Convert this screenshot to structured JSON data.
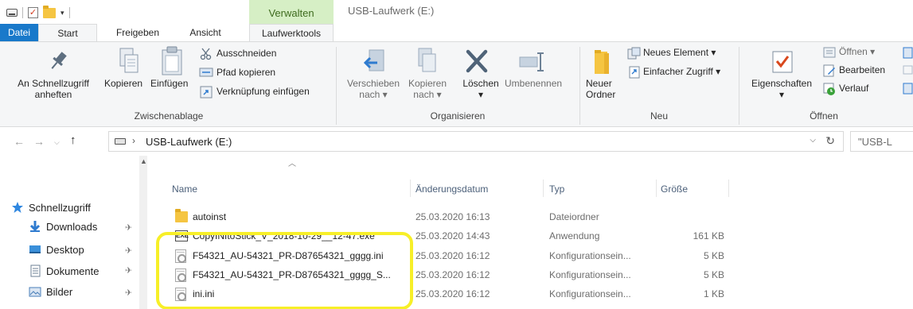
{
  "window": {
    "title": "USB-Laufwerk (E:)",
    "context_tab": "Verwalten"
  },
  "tabs": [
    {
      "label": "Datei"
    },
    {
      "label": "Start"
    },
    {
      "label": "Freigeben"
    },
    {
      "label": "Ansicht"
    },
    {
      "label": "Laufwerktools"
    }
  ],
  "ribbon": {
    "clipboard": {
      "label": "Zwischenablage",
      "pin_line1": "An Schnellzugriff",
      "pin_line2": "anheften",
      "copy": "Kopieren",
      "paste": "Einfügen",
      "cut": "Ausschneiden",
      "copy_path": "Pfad kopieren",
      "paste_shortcut": "Verknüpfung einfügen"
    },
    "organize": {
      "label": "Organisieren",
      "move_line1": "Verschieben",
      "move_line2": "nach",
      "copyto_line1": "Kopieren",
      "copyto_line2": "nach",
      "delete": "Löschen",
      "rename": "Umbenennen"
    },
    "new": {
      "label": "Neu",
      "folder_line1": "Neuer",
      "folder_line2": "Ordner",
      "new_item": "Neues Element",
      "easy_access": "Einfacher Zugriff"
    },
    "open": {
      "label": "Öffnen",
      "properties": "Eigenschaften",
      "open": "Öffnen",
      "edit": "Bearbeiten",
      "history": "Verlauf"
    }
  },
  "address": {
    "path": "USB-Laufwerk (E:)",
    "search_placeholder": "\"USB-L"
  },
  "nav": [
    {
      "label": "Schnellzugriff"
    },
    {
      "label": "Downloads"
    },
    {
      "label": "Desktop"
    },
    {
      "label": "Dokumente"
    },
    {
      "label": "Bilder"
    }
  ],
  "columns": {
    "name": "Name",
    "date": "Änderungsdatum",
    "type": "Typ",
    "size": "Größe"
  },
  "files": [
    {
      "name": "autoinst",
      "date": "25.03.2020 16:13",
      "type": "Dateiordner",
      "size": ""
    },
    {
      "name": "CopyINItoStick_V_2018-10-29__12-47.exe",
      "date": "25.03.2020 14:43",
      "type": "Anwendung",
      "size": "161 KB"
    },
    {
      "name": "F54321_AU-54321_PR-D87654321_gggg.ini",
      "date": "25.03.2020 16:12",
      "type": "Konfigurationsein...",
      "size": "5 KB"
    },
    {
      "name": "F54321_AU-54321_PR-D87654321_gggg_S...",
      "date": "25.03.2020 16:12",
      "type": "Konfigurationsein...",
      "size": "5 KB"
    },
    {
      "name": "ini.ini",
      "date": "25.03.2020 16:12",
      "type": "Konfigurationsein...",
      "size": "1 KB"
    }
  ],
  "colors": {
    "accent": "#1979ca",
    "context_tab": "#d6efc5",
    "highlight": "#f7ef28"
  }
}
